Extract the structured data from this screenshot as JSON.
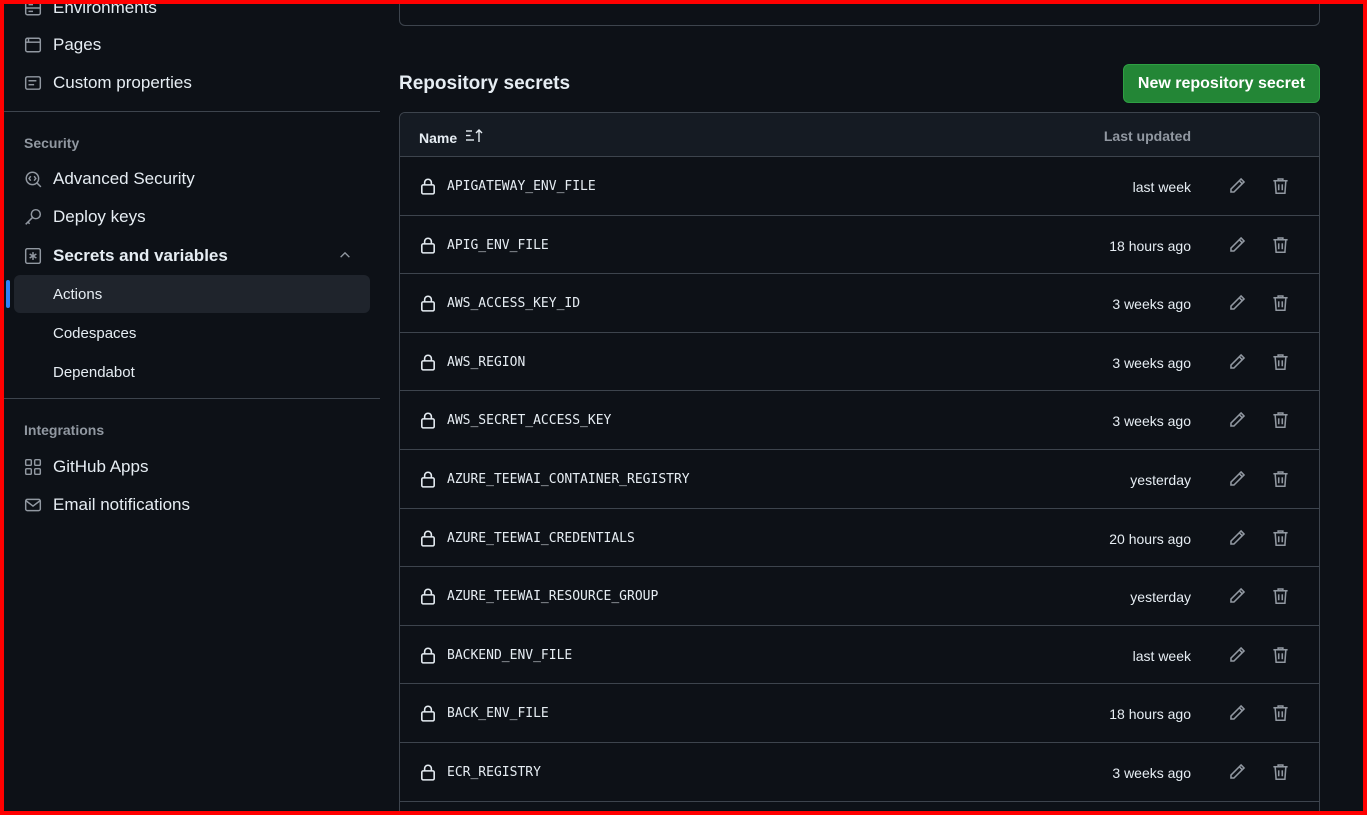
{
  "sidebar": {
    "items_top": [
      {
        "label": "Environments",
        "icon": "server-icon"
      },
      {
        "label": "Pages",
        "icon": "browser-icon"
      },
      {
        "label": "Custom properties",
        "icon": "note-icon"
      }
    ],
    "security_title": "Security",
    "security_items": [
      {
        "label": "Advanced Security",
        "icon": "codescan-icon"
      },
      {
        "label": "Deploy keys",
        "icon": "key-icon"
      },
      {
        "label": "Secrets and variables",
        "icon": "asterisk-icon"
      }
    ],
    "secrets_sub": [
      {
        "label": "Actions",
        "active": true
      },
      {
        "label": "Codespaces",
        "active": false
      },
      {
        "label": "Dependabot",
        "active": false
      }
    ],
    "integrations_title": "Integrations",
    "integrations_items": [
      {
        "label": "GitHub Apps",
        "icon": "apps-icon"
      },
      {
        "label": "Email notifications",
        "icon": "mail-icon"
      }
    ]
  },
  "main": {
    "heading": "Repository secrets",
    "new_button": "New repository secret",
    "col_name": "Name",
    "col_updated": "Last updated",
    "secrets": [
      {
        "name": "APIGATEWAY_ENV_FILE",
        "updated": "last week"
      },
      {
        "name": "APIG_ENV_FILE",
        "updated": "18 hours ago"
      },
      {
        "name": "AWS_ACCESS_KEY_ID",
        "updated": "3 weeks ago"
      },
      {
        "name": "AWS_REGION",
        "updated": "3 weeks ago"
      },
      {
        "name": "AWS_SECRET_ACCESS_KEY",
        "updated": "3 weeks ago"
      },
      {
        "name": "AZURE_TEEWAI_CONTAINER_REGISTRY",
        "updated": "yesterday"
      },
      {
        "name": "AZURE_TEEWAI_CREDENTIALS",
        "updated": "20 hours ago"
      },
      {
        "name": "AZURE_TEEWAI_RESOURCE_GROUP",
        "updated": "yesterday"
      },
      {
        "name": "BACKEND_ENV_FILE",
        "updated": "last week"
      },
      {
        "name": "BACK_ENV_FILE",
        "updated": "18 hours ago"
      },
      {
        "name": "ECR_REGISTRY",
        "updated": "3 weeks ago"
      }
    ]
  },
  "colors": {
    "accent": "#2f81f7",
    "button_green": "#238636",
    "background": "#0d1117",
    "border": "#3d444d",
    "frame": "#ff0000"
  }
}
